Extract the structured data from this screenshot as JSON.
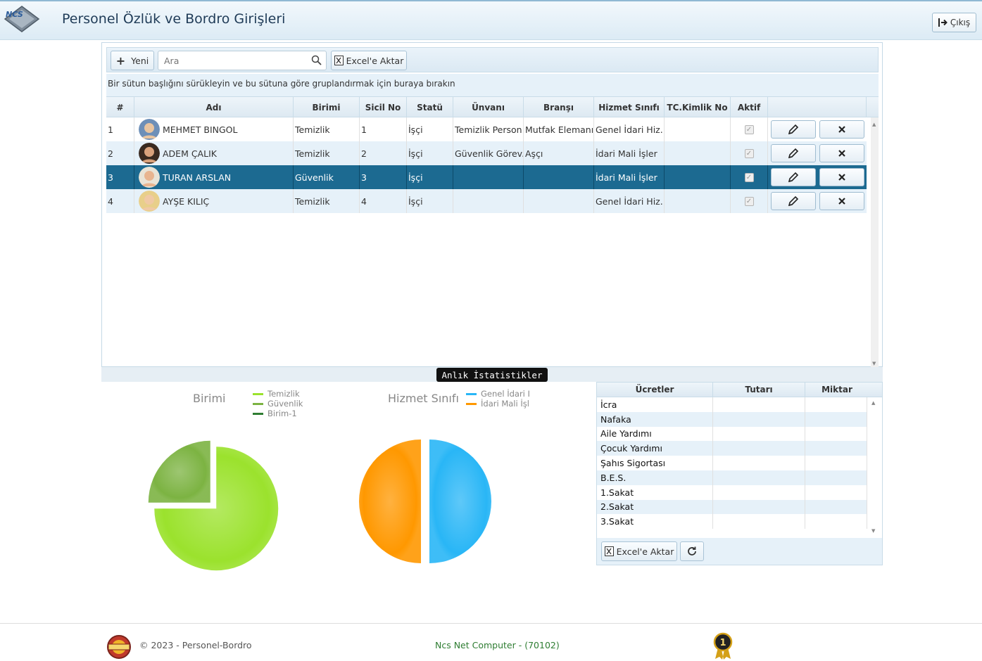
{
  "header": {
    "title": "Personel Özlük ve Bordro Girişleri",
    "logout_label": "Çıkış",
    "logo_text": "NCS"
  },
  "toolbar": {
    "new_label": "Yeni",
    "search_placeholder": "Ara",
    "excel_label": "Excel'e Aktar"
  },
  "group_panel_text": "Bir sütun başlığını sürükleyin ve bu sütuna göre gruplandırmak için buraya bırakın",
  "grid": {
    "columns": [
      "#",
      "Adı",
      "Birimi",
      "Sicil No",
      "Statü",
      "Ünvanı",
      "Branşı",
      "Hizmet Sınıfı",
      "TC.Kimlik No",
      "Aktif"
    ],
    "rows": [
      {
        "no": "1",
        "name": "MEHMET BINGOL",
        "unit": "Temizlik",
        "sicil": "1",
        "status": "İşçi",
        "title": "Temizlik Person...",
        "branch": "Mutfak Elemanı",
        "service": "Genel İdari Hiz...",
        "tc": "",
        "active": true,
        "selected": false
      },
      {
        "no": "2",
        "name": "ADEM ÇALIK",
        "unit": "Temizlik",
        "sicil": "2",
        "status": "İşçi",
        "title": "Güvenlik Görev...",
        "branch": "Aşçı",
        "service": "İdari Mali İşler",
        "tc": "",
        "active": true,
        "selected": false
      },
      {
        "no": "3",
        "name": "TURAN ARSLAN",
        "unit": "Güvenlik",
        "sicil": "3",
        "status": "İşçi",
        "title": "",
        "branch": "",
        "service": "İdari Mali İşler",
        "tc": "",
        "active": true,
        "selected": true
      },
      {
        "no": "4",
        "name": "AYŞE KILIÇ",
        "unit": "Temizlik",
        "sicil": "4",
        "status": "İşçi",
        "title": "",
        "branch": "",
        "service": "Genel İdari Hiz...",
        "tc": "",
        "active": true,
        "selected": false
      }
    ]
  },
  "stats_tab_label": "Anlık İstatistikler",
  "chart_data": [
    {
      "type": "pie",
      "title": "Birimi",
      "series": [
        {
          "name": "Temizlik",
          "value": 3,
          "color": "#9be22d"
        },
        {
          "name": "Güvenlik",
          "value": 1,
          "color": "#7cb342"
        },
        {
          "name": "Birim-1",
          "value": 0,
          "color": "#2e7d32"
        }
      ]
    },
    {
      "type": "pie",
      "title": "Hizmet Sınıfı",
      "series": [
        {
          "name": "Genel İdari I",
          "value": 2,
          "color": "#29b6f6"
        },
        {
          "name": "İdari Mali İşl",
          "value": 2,
          "color": "#ff9800"
        }
      ]
    }
  ],
  "wages": {
    "columns": [
      "Ücretler",
      "Tutarı",
      "Miktar"
    ],
    "rows": [
      "İcra",
      "Nafaka",
      "Aile Yardımı",
      "Çocuk Yardımı",
      "Şahıs Sigortası",
      "B.E.S.",
      "1.Sakat",
      "2.Sakat",
      "3.Sakat"
    ],
    "excel_label": "Excel'e Aktar"
  },
  "footer": {
    "copyright": "© 2023 - Personel-Bordro",
    "company": "Ncs Net Computer - (70102)",
    "badge_number": "1"
  },
  "colors": {
    "selected_row": "#1c6a91",
    "header_text": "#1f3b57",
    "company_text": "#2e7d32"
  }
}
